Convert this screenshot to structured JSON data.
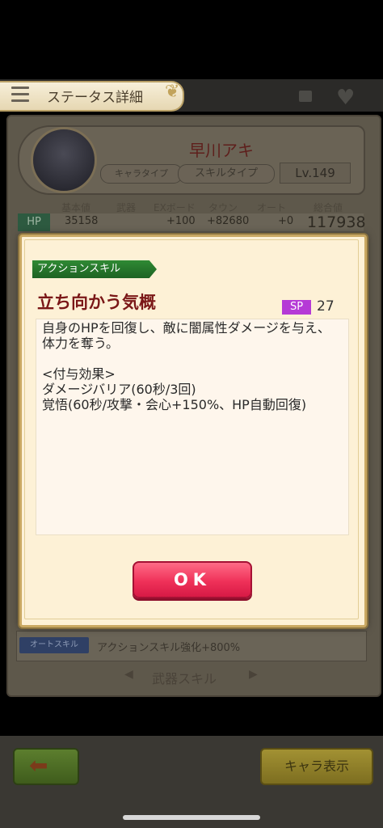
{
  "header": {
    "title": "ステータス詳細",
    "menu_icon": "hamburger-icon",
    "ornament_icon": "scroll-ornament-icon"
  },
  "profile": {
    "name": "早川アキ",
    "chara_type_label": "キャラタイプ",
    "skill_type_label": "スキルタイプ",
    "level": "Lv.149"
  },
  "stats": {
    "headers": [
      "基本値",
      "武器",
      "EXボード",
      "タウン",
      "オート",
      "総合値"
    ],
    "hp_label": "HP",
    "values": [
      "35158",
      "+100",
      "+82680",
      "+0"
    ],
    "total": "117938"
  },
  "auto_skill": {
    "badge": "オートスキル",
    "text": "アクションスキル強化+800%"
  },
  "weapon_skill_label": "武器スキル",
  "bottom": {
    "back_icon": "back-arrow-icon",
    "chara_button": "キャラ表示"
  },
  "dialog": {
    "category": "アクションスキル",
    "skill_name": "立ち向かう気概",
    "sp_label": "SP",
    "sp_value": "27",
    "description": "自身のHPを回復し、敵に闇属性ダメージを与え、体力を奪う。\n\n<付与効果>\nダメージバリア(60秒/3回)\n覚悟(60秒/攻撃・会心+150%、HP自動回復)",
    "ok_label": "OK"
  },
  "colors": {
    "dialog_bg": "#fdf1d6",
    "ribbon_green": "#2f8a34",
    "skill_name_red": "#7a1717",
    "sp_purple": "#b53ad6",
    "ok_pink": "#ef3159"
  }
}
